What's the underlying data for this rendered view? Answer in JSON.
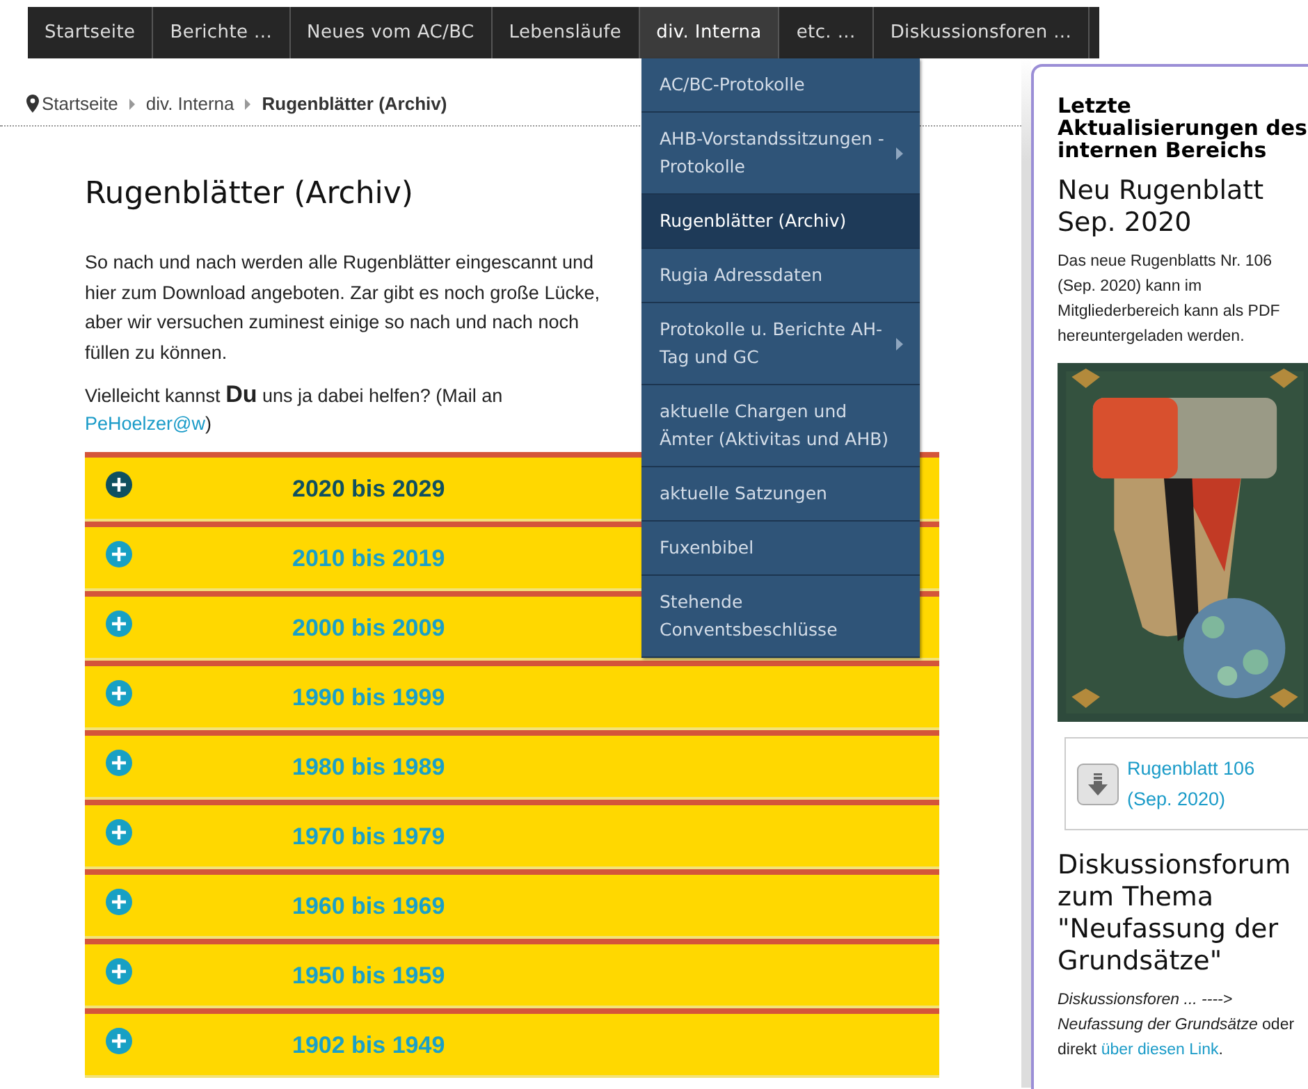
{
  "nav": [
    {
      "label": "Startseite",
      "selected": false
    },
    {
      "label": "Berichte ...",
      "selected": false
    },
    {
      "label": "Neues vom AC/BC",
      "selected": false
    },
    {
      "label": "Lebensläufe",
      "selected": false
    },
    {
      "label": "div. Interna",
      "selected": true
    },
    {
      "label": "etc. ...",
      "selected": false
    },
    {
      "label": "Diskussionsforen ...",
      "selected": false
    }
  ],
  "dropdown": [
    {
      "label": "AC/BC-Protokolle",
      "selected": false,
      "has_submenu": false
    },
    {
      "label": "AHB-Vorstandssitzungen - Protokolle",
      "selected": false,
      "has_submenu": true
    },
    {
      "label": "Rugenblätter (Archiv)",
      "selected": true,
      "has_submenu": false
    },
    {
      "label": "Rugia Adressdaten",
      "selected": false,
      "has_submenu": false
    },
    {
      "label": "Protokolle u. Berichte AH-Tag und GC",
      "selected": false,
      "has_submenu": true
    },
    {
      "label": "aktuelle Chargen und Ämter (Aktivitas und AHB)",
      "selected": false,
      "has_submenu": false
    },
    {
      "label": "aktuelle Satzungen",
      "selected": false,
      "has_submenu": false
    },
    {
      "label": "Fuxenbibel",
      "selected": false,
      "has_submenu": false
    },
    {
      "label": "Stehende Conventsbeschlüsse",
      "selected": false,
      "has_submenu": false
    }
  ],
  "breadcrumb": [
    "Startseite",
    "div. Interna",
    "Rugenblätter (Archiv)"
  ],
  "title": "Rugenblätter (Archiv)",
  "intro": "So nach und nach werden alle Rugenblätter eingescannt und hier zum Download angeboten. Zar gibt es noch große Lücke, aber wir versuchen zuminest einige so nach und nach noch füllen zu können.",
  "help": {
    "text": "Vielleicht kannst **Du** uns ja dabei helfen? (Mail an ",
    "link": "PeHoelzer@w",
    "after": ")"
  },
  "accordion": [
    {
      "label": "2020 bis 2029",
      "selected": true
    },
    {
      "label": "2010 bis 2019",
      "selected": false
    },
    {
      "label": "2000 bis 2009",
      "selected": false
    },
    {
      "label": "1990 bis 1999",
      "selected": false
    },
    {
      "label": "1980 bis 1989",
      "selected": false
    },
    {
      "label": "1970 bis 1979",
      "selected": false
    },
    {
      "label": "1960 bis 1969",
      "selected": false
    },
    {
      "label": "1950 bis 1959",
      "selected": false
    },
    {
      "label": "1902 bis 1949",
      "selected": false
    }
  ],
  "sidebar": {
    "heading": "Letzte Aktualisierungen des internen Bereichs",
    "news_title": "Neu Rugenblatt Sep. 2020",
    "news_text": "Das neue Rugenblatts Nr. 106 (Sep. 2020) kann im Mitgliederbereich kann als PDF hereuntergeladen werden.",
    "download": "Rugenblatt 106 (Sep. 2020)",
    "forum_title": "Diskussionsforum zum Thema \"Neufassung der Grundsätze\"",
    "forum_text": "*Diskussionsforen ... ----> Neufassung der Grundsätze* oder direkt ",
    "forum_link": "über diesen Link",
    "forum_after": "."
  }
}
